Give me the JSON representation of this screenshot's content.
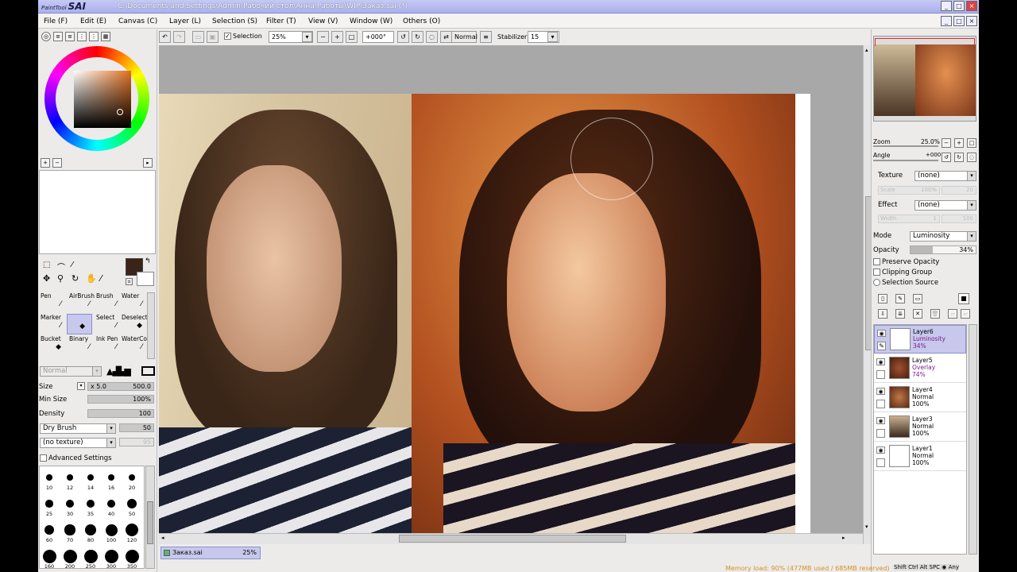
{
  "app": {
    "logo_small": "PaintTool",
    "logo_big": "SAI",
    "title": "C:\\Documents and Settings\\Admin\\Рабочий стол\\Анна\\Работы\\WIP\\Заказ.sai (*)"
  },
  "window_buttons": [
    "_",
    "□",
    "×"
  ],
  "menu": [
    "File (F)",
    "Edit (E)",
    "Canvas (C)",
    "Layer (L)",
    "Selection (S)",
    "Filter (T)",
    "View (V)",
    "Window (W)",
    "Others (O)"
  ],
  "toolbar": {
    "selection_label": "Selection",
    "zoom": "25%",
    "angle": "+000°",
    "blend": "Normal",
    "stabilizer_label": "Stabilizer",
    "stabilizer_value": "15"
  },
  "left": {
    "tools": [
      {
        "label": "Pen"
      },
      {
        "label": "AirBrush"
      },
      {
        "label": "Brush"
      },
      {
        "label": "Water"
      },
      {
        "label": "Marker"
      },
      {
        "label": ""
      },
      {
        "label": "Select"
      },
      {
        "label": "Deselect"
      },
      {
        "label": "Bucket"
      },
      {
        "label": "Binary"
      },
      {
        "label": "Ink Pen"
      },
      {
        "label": "WaterCo"
      }
    ],
    "blend_mode": "Normal",
    "size_label": "Size",
    "size_mult": "x 5.0",
    "size_value": "500.0",
    "minsize_label": "Min Size",
    "minsize_value": "100%",
    "density_label": "Density",
    "density_value": "100",
    "brush_shape": "Dry Brush",
    "brush_shape_value": "50",
    "texture": "(no texture)",
    "texture_value": "95",
    "advanced_label": "Advanced Settings",
    "dot_sizes": [
      "10",
      "12",
      "14",
      "16",
      "20",
      "25",
      "30",
      "35",
      "40",
      "50",
      "60",
      "70",
      "80",
      "100",
      "120",
      "160",
      "200",
      "250",
      "300",
      "350"
    ]
  },
  "document": {
    "tab": "Заказ.sai",
    "zoom": "25%"
  },
  "right": {
    "zoom_label": "Zoom",
    "zoom_value": "25.0%",
    "angle_label": "Angle",
    "angle_value": "+000.0",
    "texture_label": "Texture",
    "texture_value": "(none)",
    "scale_label": "Scale",
    "scale_value": "100%",
    "scale_num": "20",
    "effect_label": "Effect",
    "effect_value": "(none)",
    "width_label": "Width",
    "width_value": "1",
    "width_num": "100",
    "mode_label": "Mode",
    "mode_value": "Luminosity",
    "opacity_label": "Opacity",
    "opacity_value": "34%",
    "preserve_opacity": "Preserve Opacity",
    "clipping_group": "Clipping Group",
    "selection_source": "Selection Source",
    "layers": [
      {
        "name": "Layer6",
        "mode": "Luminosity",
        "opacity": "34%"
      },
      {
        "name": "Layer5",
        "mode": "Overlay",
        "opacity": "74%"
      },
      {
        "name": "Layer4",
        "mode": "Normal",
        "opacity": "100%"
      },
      {
        "name": "Layer3",
        "mode": "Normal",
        "opacity": "100%"
      },
      {
        "name": "Layer1",
        "mode": "Normal",
        "opacity": "100%"
      }
    ]
  },
  "status": {
    "memory": "Memory load: 90% (477MB used / 685MB reserved)",
    "keys": "Shift Ctrl Alt SPC ◉ Any"
  },
  "colors": {
    "accent": "#c7c8ec",
    "title": "#aab1ec",
    "current_color": "#3a2418"
  }
}
